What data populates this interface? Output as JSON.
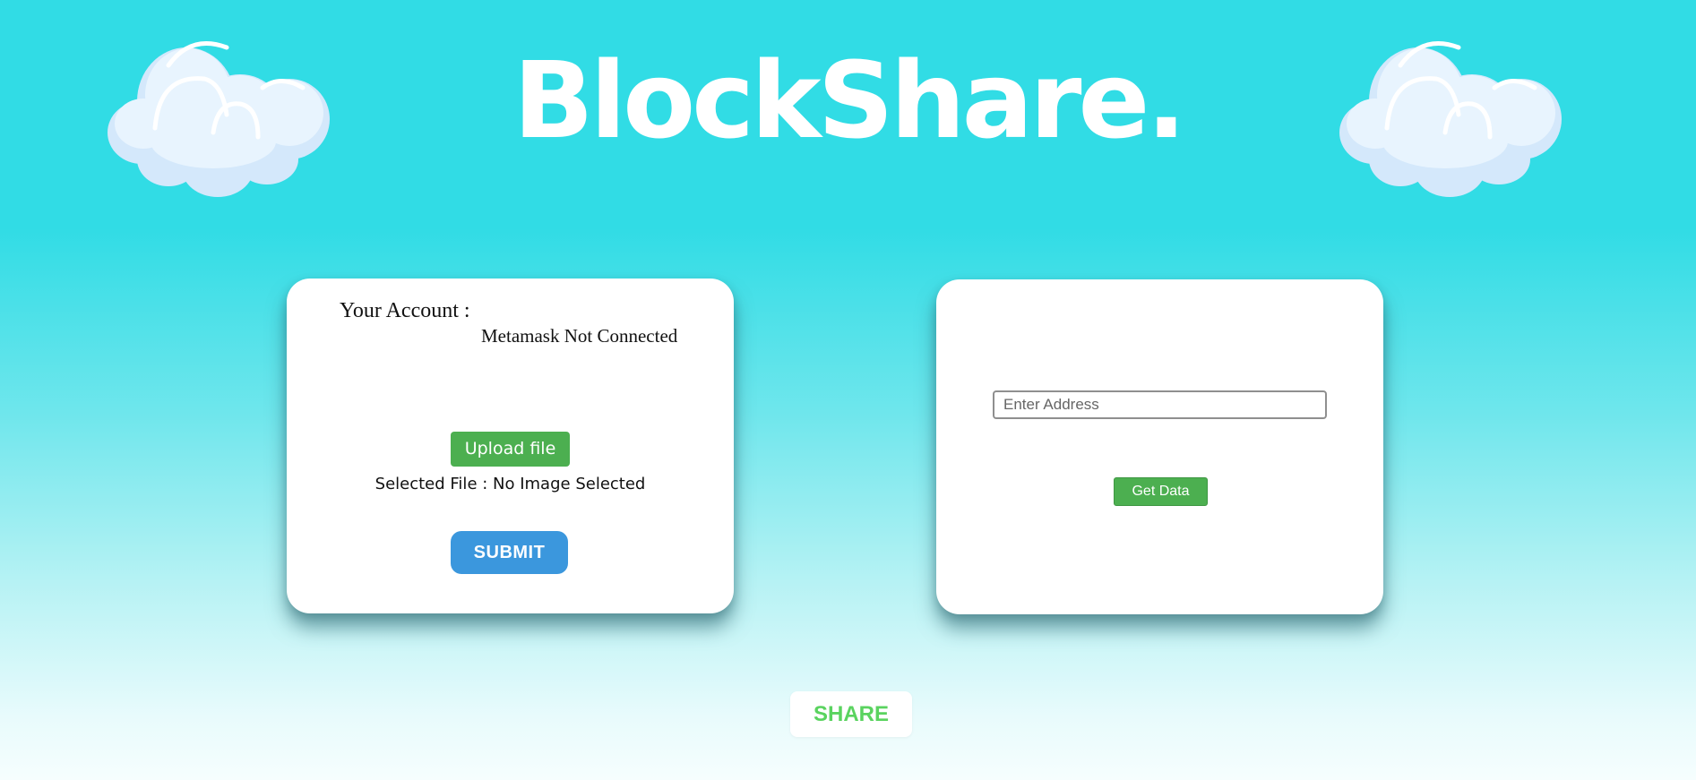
{
  "header": {
    "brand_title": "BlockShare."
  },
  "decorations": {
    "left_icon": "cloud-icon",
    "right_icon": "cloud-icon"
  },
  "account_card": {
    "account_label": "Your Account :",
    "account_value": "Metamask Not Connected",
    "upload_button_label": "Upload file",
    "selected_file_text": "Selected File : No Image Selected",
    "submit_button_label": "SUBMIT"
  },
  "lookup_card": {
    "address_placeholder": "Enter Address",
    "address_value": "",
    "get_data_button_label": "Get Data"
  },
  "footer": {
    "share_button_label": "SHARE"
  },
  "colors": {
    "background_top": "#31dce5",
    "background_bottom": "#f6fefe",
    "upload_button": "#4caf50",
    "submit_button": "#3b97dd",
    "get_data_button": "#4caf50",
    "share_text": "#5ad35f"
  }
}
